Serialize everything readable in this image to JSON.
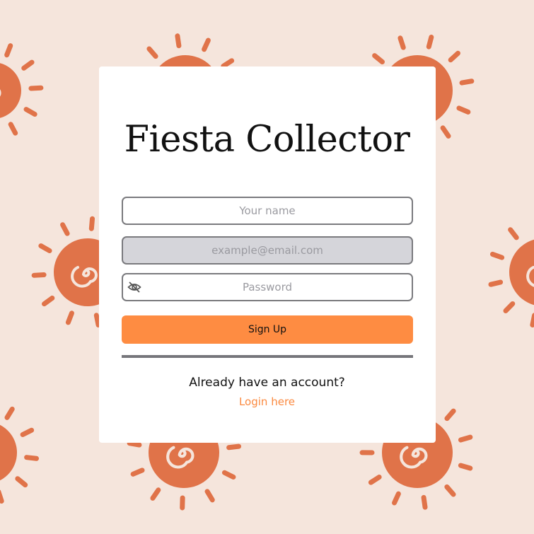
{
  "app": {
    "title": "Fiesta Collector"
  },
  "form": {
    "name_placeholder": "Your name",
    "email_placeholder": "example@email.com",
    "password_placeholder": "Password",
    "name_value": "",
    "email_value": "",
    "password_value": "",
    "password_toggle_icon": "eye-off-icon",
    "signup_label": "Sign Up"
  },
  "footer": {
    "already_text": "Already have an account?",
    "login_link": "Login here"
  },
  "colors": {
    "background": "#f5e5dc",
    "sun": "#e07349",
    "accent": "#fe8c42",
    "card": "#ffffff"
  }
}
